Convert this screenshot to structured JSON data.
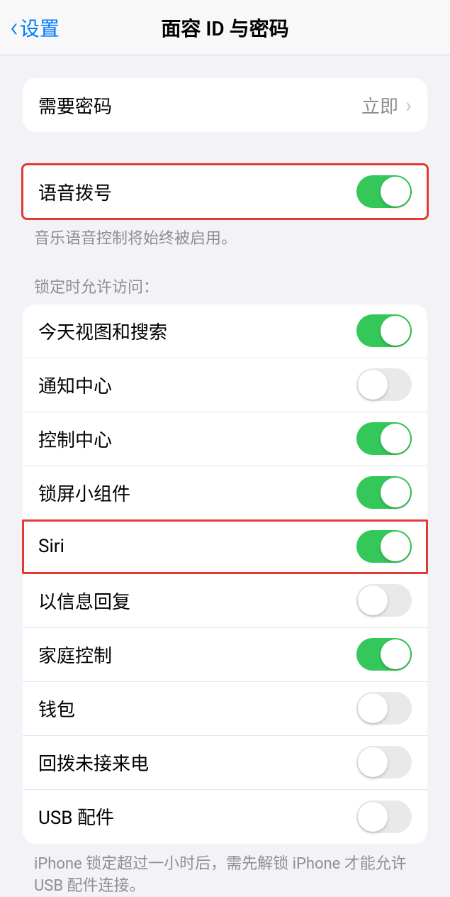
{
  "nav": {
    "back": "设置",
    "title": "面容 ID 与密码"
  },
  "require_passcode": {
    "label": "需要密码",
    "value": "立即"
  },
  "voice_dial": {
    "label": "语音拨号",
    "footer": "音乐语音控制将始终被启用。",
    "on": true
  },
  "lock_header": "锁定时允许访问：",
  "lock_items": [
    {
      "label": "今天视图和搜索",
      "on": true
    },
    {
      "label": "通知中心",
      "on": false
    },
    {
      "label": "控制中心",
      "on": true
    },
    {
      "label": "锁屏小组件",
      "on": true
    },
    {
      "label": "Siri",
      "on": true,
      "highlight": true
    },
    {
      "label": "以信息回复",
      "on": false
    },
    {
      "label": "家庭控制",
      "on": true
    },
    {
      "label": "钱包",
      "on": false
    },
    {
      "label": "回拨未接来电",
      "on": false
    },
    {
      "label": "USB 配件",
      "on": false
    }
  ],
  "usb_footer": "iPhone 锁定超过一小时后，需先解锁 iPhone 才能允许 USB 配件连接。"
}
